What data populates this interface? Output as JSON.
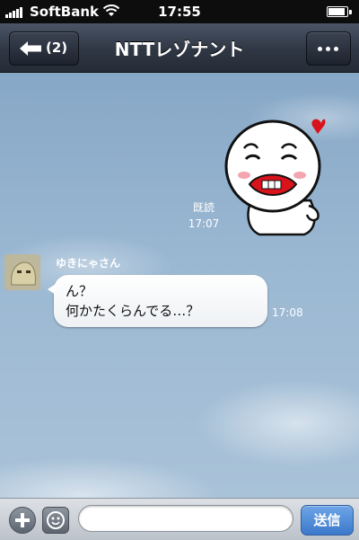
{
  "status_bar": {
    "carrier": "SoftBank",
    "time": "17:55",
    "icons": [
      "signal-icon",
      "wifi-icon",
      "battery-icon"
    ]
  },
  "nav": {
    "back_count": "(2)",
    "title": "NTTレゾナント",
    "icons": [
      "back-arrow-icon",
      "more-dots-icon"
    ]
  },
  "chat": {
    "own_message": {
      "type": "sticker",
      "read_label": "既読",
      "time": "17:07"
    },
    "incoming_message": {
      "sender": "ゆきにゃさん",
      "lines": [
        "ん？",
        "何かたくらんでる…？"
      ],
      "time": "17:08"
    }
  },
  "input_bar": {
    "value": "",
    "send_label": "送信",
    "icons": [
      "plus-icon",
      "emoji-icon"
    ]
  },
  "colors": {
    "nav_bar": "#2f3744",
    "send_button": "#3c79cc",
    "sky": "#9bb8d2"
  }
}
